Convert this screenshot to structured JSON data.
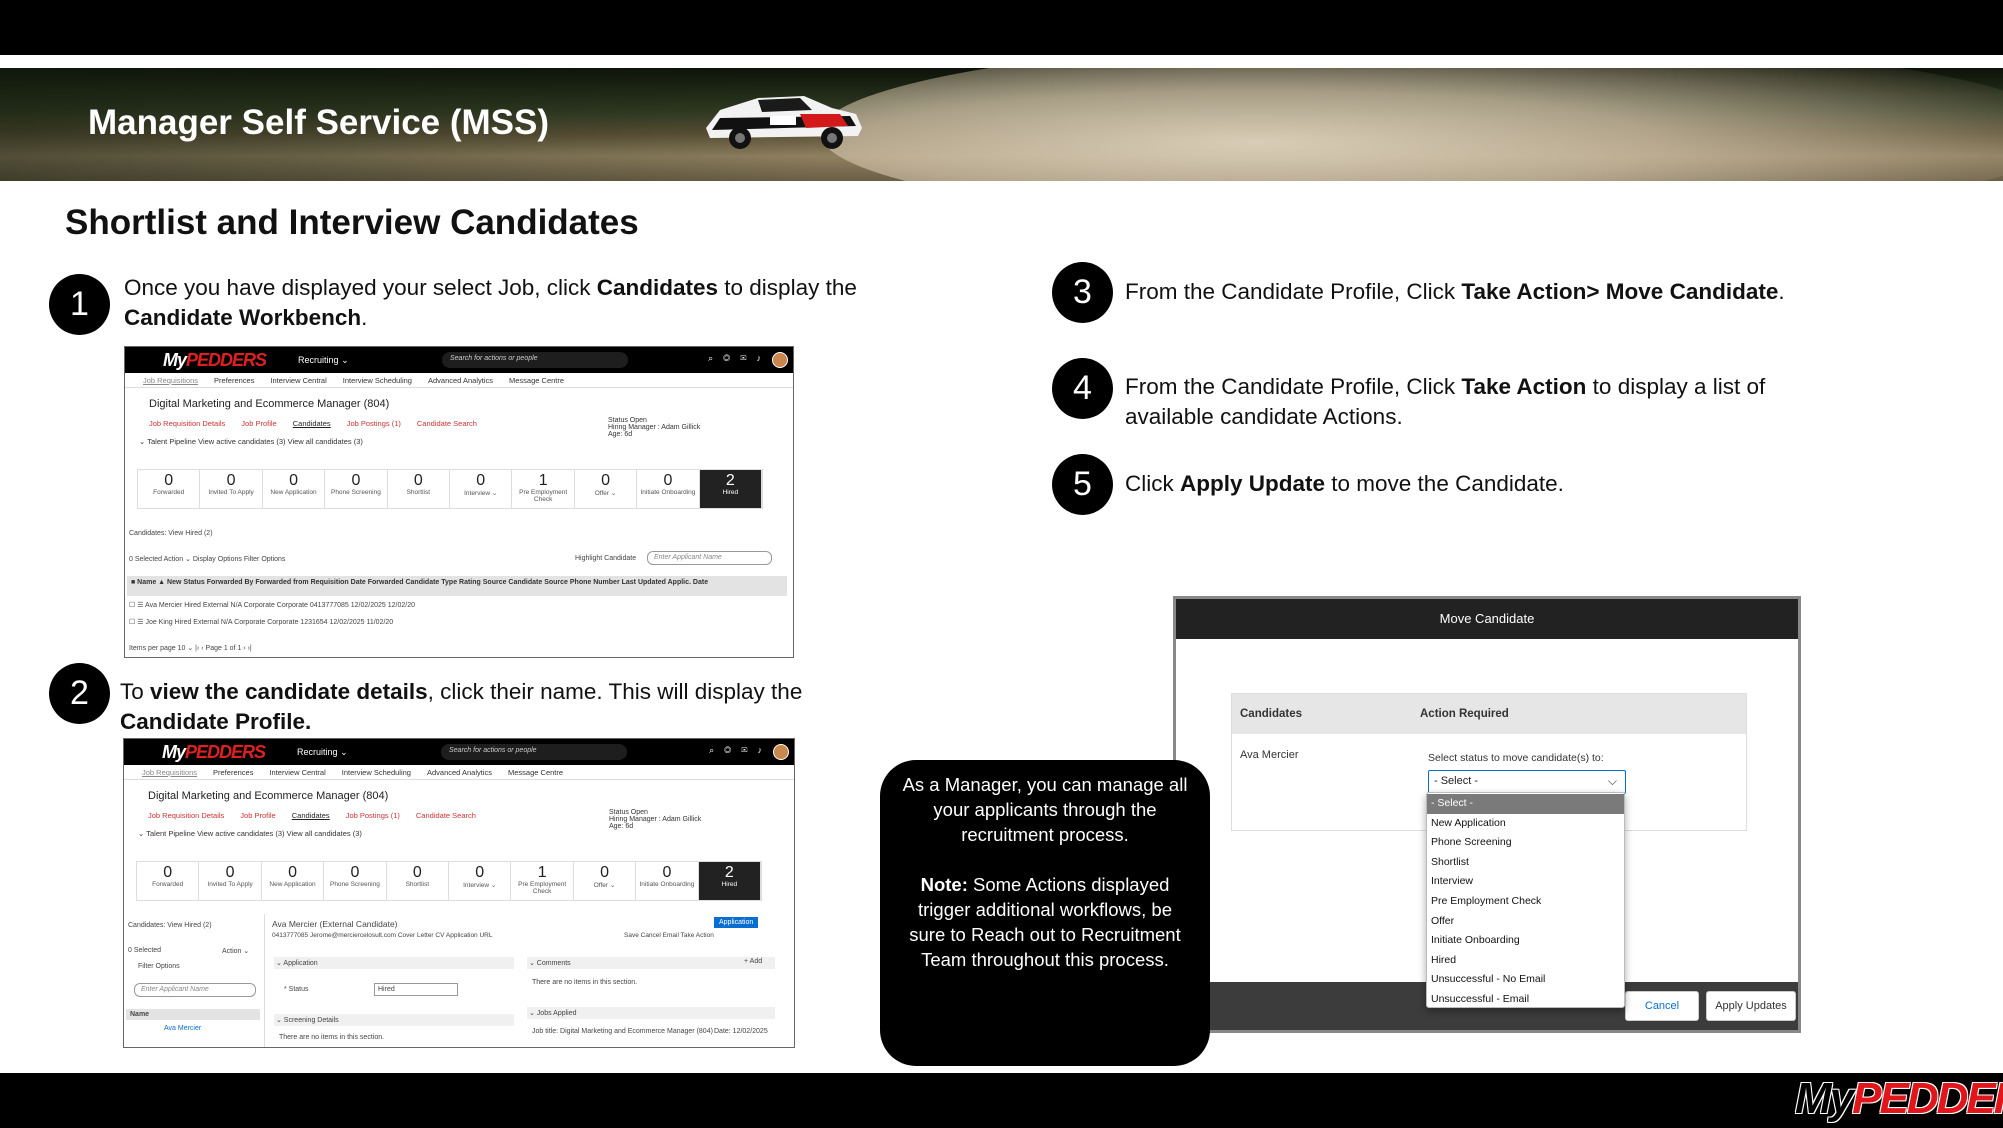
{
  "banner": {
    "title": "Manager Self Service (MSS)"
  },
  "page": {
    "title": "Shortlist and Interview Candidates"
  },
  "steps": [
    {
      "number": "1",
      "text_a": "Once you have displayed your select Job, click ",
      "bold_a": "Candidates",
      "text_b": " to display the ",
      "bold_b": "Candidate Workbench",
      "text_c": "."
    },
    {
      "number": "2",
      "text_a": "To ",
      "bold_a": "view the candidate details",
      "text_b": ", click their name. This will display the ",
      "bold_b": "Candidate Profile.",
      "text_c": ""
    },
    {
      "number": "3",
      "text_a": "From the Candidate Profile, Click ",
      "bold_a": "Take Action> Move Candidate",
      "text_b": ".",
      "bold_b": "",
      "text_c": ""
    },
    {
      "number": "4",
      "text_a": "From the Candidate Profile, Click ",
      "bold_a": "Take Action",
      "text_b": " to display a list of available candidate Actions.",
      "bold_b": "",
      "text_c": ""
    },
    {
      "number": "5",
      "text_a": "Click ",
      "bold_a": "Apply Update",
      "text_b": " to move the Candidate.",
      "bold_b": "",
      "text_c": ""
    }
  ],
  "app": {
    "logo_my": "My",
    "logo_brand": "PEDDERS",
    "module": "Recruiting ⌄",
    "search_placeholder": "Search for actions or people",
    "menu": [
      "Job Requisitions",
      "Preferences",
      "Interview Central",
      "Interview Scheduling",
      "Advanced Analytics",
      "Message Centre"
    ],
    "job_title": "Digital Marketing and Ecommerce Manager (804)",
    "job_tabs": [
      "Job Requisition Details",
      "Job Profile",
      "Candidates",
      "Job Postings (1)",
      "Candidate Search"
    ],
    "status_text": "Status  Open",
    "hiring_manager": "Hiring Manager : Adam Gillick",
    "age": "Age: 6d",
    "talent_pipeline": "⌄ Talent Pipeline   View active candidates (3)   View all candidates (3)",
    "pipeline": [
      {
        "count": "0",
        "label": "Forwarded"
      },
      {
        "count": "0",
        "label": "Invited To Apply"
      },
      {
        "count": "0",
        "label": "New Application"
      },
      {
        "count": "0",
        "label": "Phone Screening"
      },
      {
        "count": "0",
        "label": "Shortlist"
      },
      {
        "count": "0",
        "label": "Interview ⌄"
      },
      {
        "count": "1",
        "label": "Pre Employment Check"
      },
      {
        "count": "0",
        "label": "Offer ⌄"
      },
      {
        "count": "0",
        "label": "Initiate Onboarding"
      },
      {
        "count": "2",
        "label": "Hired"
      }
    ],
    "view_hired": "Candidates: View Hired (2)",
    "toolbar": "0 Selected    Action ⌄      Display Options      Filter Options",
    "highlight": "Highlight Candidate",
    "highlight_placeholder": "Enter Applicant Name",
    "grid_header": "■  Name ▲       New  Status  Forwarded By   Forwarded from Requisition   Date Forwarded   Candidate Type   Rating  Source   Candidate Source  Phone Number  Last Updated  Applic. Date",
    "grid_rows": [
      "☐  ☰  Ava Mercier            Hired                                                    External        N/A   Corporate  Corporate       0413777085      12/02/2025      12/02/20",
      "☐  ☰  Joe King                Hired                                                    External        N/A   Corporate  Corporate       1231654           12/02/2025      11/02/20"
    ],
    "pager": "Items per page  10 ⌄      |‹  ‹  Page  1  of 1  ›  ›|",
    "profile_name": "Ava Mercier (External Candidate)",
    "profile_contacts": "0413777085   Jerome@merciercelosult.com   Cover Letter   CV   Application URL",
    "profile_tab": "Application",
    "profile_actions": "Save   Cancel   Email   Take Action",
    "section_application": "⌄  Application",
    "status_field": "* Status",
    "status_value": "Hired",
    "section_screening": "⌄  Screening Details",
    "no_items": "There are no items in this section.",
    "section_comments": "⌄  Comments",
    "add": "+ Add",
    "section_jobs": "⌄  Jobs Applied",
    "job_applied": "Job title: Digital Marketing and Ecommerce Manager (804)",
    "job_date": "Date: 12/02/2025",
    "left_selected": "0 Selected",
    "left_action": "Action ⌄",
    "filter_options": "Filter Options",
    "left_name_header": "Name",
    "left_name": "Ava Mercier"
  },
  "dialog": {
    "title": "Move Candidate",
    "col_candidates": "Candidates",
    "col_action": "Action Required",
    "candidate": "Ava Mercier",
    "status_label": "Select status to move candidate(s) to:",
    "select_value": "- Select -",
    "options": [
      "- Select -",
      "New Application",
      "Phone Screening",
      "Shortlist",
      "Interview",
      "Pre Employment Check",
      "Offer",
      "Initiate Onboarding",
      "Hired",
      "Unsuccessful - No Email",
      "Unsuccessful - Email"
    ],
    "cancel": "Cancel",
    "apply": "Apply Updates"
  },
  "callout": {
    "text_a": "As a Manager, you can manage all your applicants through the recruitment process.",
    "note_label": "Note:",
    "note_text": " Some Actions displayed trigger additional workflows, be sure to Reach out to Recruitment Team throughout this process."
  },
  "footer": {
    "logo_my": "My",
    "logo_brand": "PEDDERS"
  }
}
